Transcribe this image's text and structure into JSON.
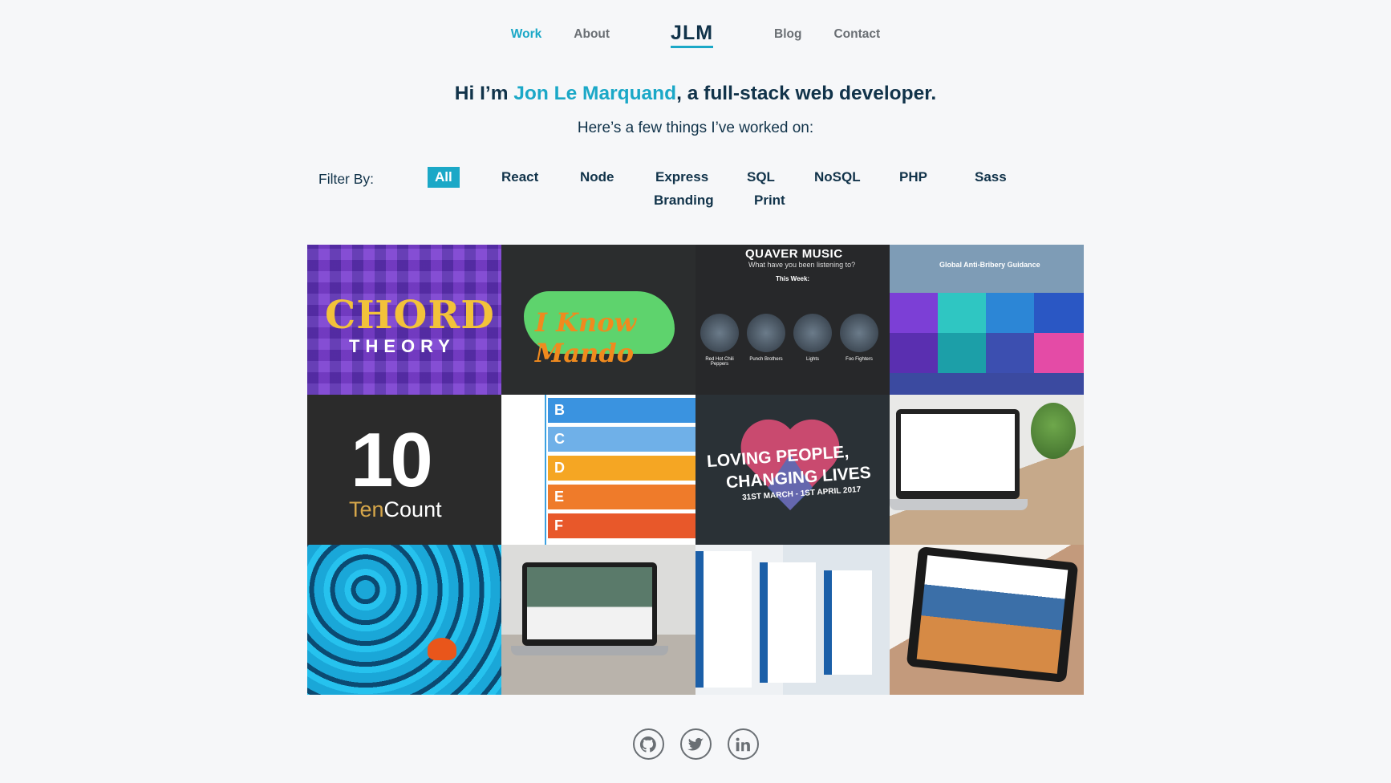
{
  "nav": {
    "work": "Work",
    "about": "About",
    "logo": "JLM",
    "blog": "Blog",
    "contact": "Contact"
  },
  "hero": {
    "greeting_prefix": "Hi I’m ",
    "name": "Jon Le Marquand",
    "greeting_suffix": ", a full-stack web developer.",
    "subtitle": "Here’s a few things I’ve worked on:"
  },
  "filters": {
    "label": "Filter By:",
    "options": [
      "All",
      "React",
      "Node",
      "Express",
      "SQL",
      "NoSQL",
      "PHP",
      "Sass",
      "Branding",
      "Print"
    ],
    "selected": "All"
  },
  "projects": {
    "chord": {
      "line1": "CHORD",
      "line2": "THEORY"
    },
    "mando": {
      "title": "I Know Mando"
    },
    "quaver": {
      "title": "QUAVER MUSIC",
      "subtitle": "What have you been listening to?",
      "week": "This Week:",
      "bands": [
        "Red Hot Chili Peppers",
        "Punch Brothers",
        "Lights",
        "Foo Fighters"
      ]
    },
    "bribery": {
      "title": "Global Anti-Bribery Guidance"
    },
    "tencount": {
      "number": "10",
      "ten": "Ten",
      "count": "Count"
    },
    "abc": {
      "letters": [
        "B",
        "C",
        "D",
        "E",
        "F"
      ]
    },
    "loving": {
      "line1": "LOVING PEOPLE,",
      "line2": "CHANGING LIVES",
      "line3": "31ST MARCH - 1ST APRIL 2017"
    }
  },
  "colors": {
    "accent": "#1ba8c7",
    "heading": "#11334a",
    "background": "#f6f7f9",
    "muted": "#6a6f74"
  },
  "social": {
    "icons": [
      "github-icon",
      "twitter-icon",
      "linkedin-icon"
    ]
  }
}
